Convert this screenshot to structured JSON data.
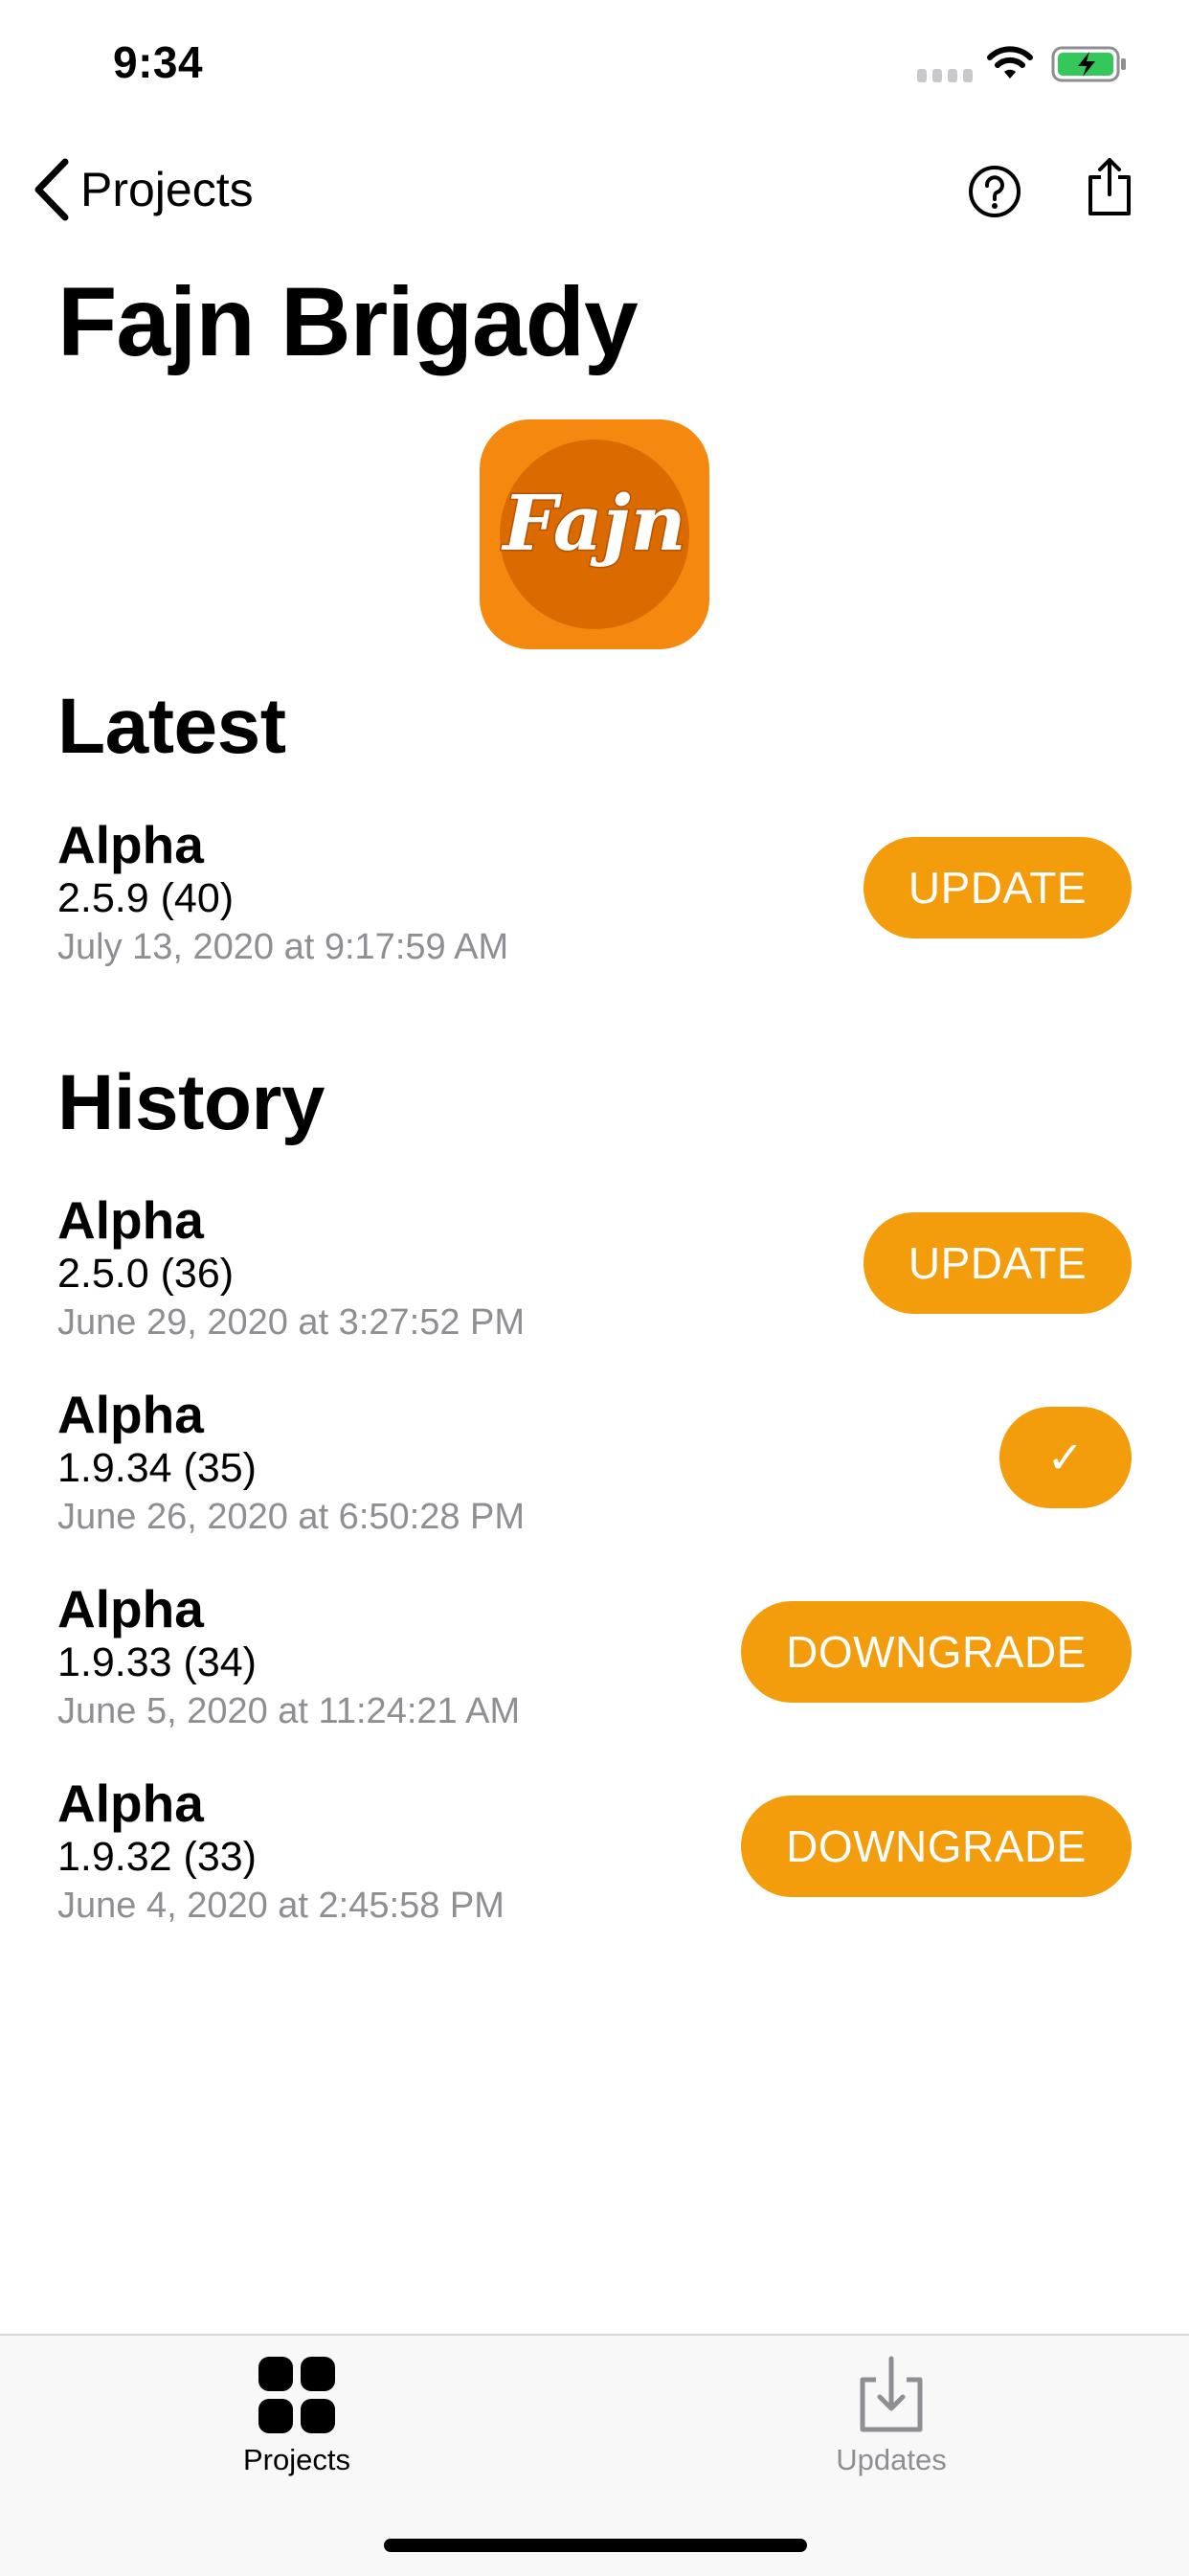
{
  "status_bar": {
    "time": "9:34"
  },
  "nav": {
    "back_label": "Projects"
  },
  "page": {
    "title": "Fajn Brigady"
  },
  "app_icon": {
    "text": "Fajn",
    "color": "#f5890f",
    "inner_color": "#db6b00"
  },
  "latest": {
    "title": "Latest",
    "item": {
      "name": "Alpha",
      "version": "2.5.9 (40)",
      "date": "July 13, 2020 at 9:17:59 AM",
      "action": "UPDATE"
    }
  },
  "history": {
    "title": "History",
    "items": [
      {
        "name": "Alpha",
        "version": "2.5.0 (36)",
        "date": "June 29, 2020 at 3:27:52 PM",
        "action": "UPDATE"
      },
      {
        "name": "Alpha",
        "version": "1.9.34 (35)",
        "date": "June 26, 2020 at 6:50:28 PM",
        "action": "✓"
      },
      {
        "name": "Alpha",
        "version": "1.9.33 (34)",
        "date": "June 5, 2020 at 11:24:21 AM",
        "action": "DOWNGRADE"
      },
      {
        "name": "Alpha",
        "version": "1.9.32 (33)",
        "date": "June 4, 2020 at 2:45:58 PM",
        "action": "DOWNGRADE"
      }
    ]
  },
  "tabbar": {
    "tabs": [
      {
        "label": "Projects",
        "icon": "grid-icon",
        "selected": true
      },
      {
        "label": "Updates",
        "icon": "download-tray-icon",
        "selected": false
      }
    ]
  },
  "colors": {
    "accent": "#f39c0c",
    "secondary_text": "#8e8e93"
  }
}
